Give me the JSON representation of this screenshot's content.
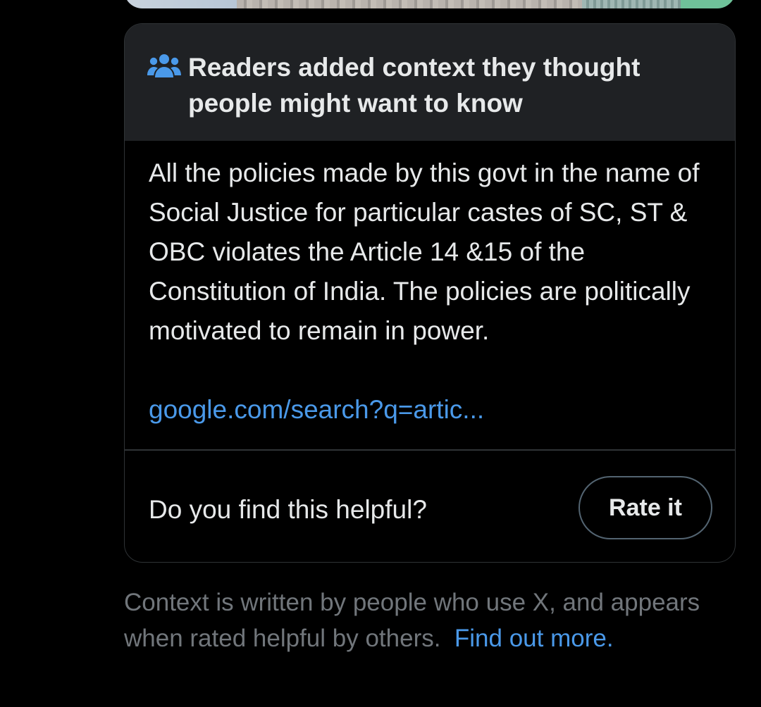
{
  "colors": {
    "background": "#000000",
    "header_bg": "#1f2124",
    "text_primary": "#e7e9ea",
    "text_secondary": "#71767b",
    "link": "#4a99e9",
    "border": "#2f3336",
    "accent_icon": "#4a99e9"
  },
  "media_preview": {
    "icon": "image-thumbnail-strip"
  },
  "community_note": {
    "header_icon": "people-icon",
    "header_title": "Readers added context they thought people might want to know",
    "body": "All the policies made by this govt in the name of Social Justice for particular castes of SC, ST & OBC violates the Article 14 &15 of the Constitution of India. The policies are politically motivated to remain in power.",
    "link_text": "google.com/search?q=artic...",
    "helpful_question": "Do you find this helpful?",
    "rate_button_label": "Rate it"
  },
  "footer": {
    "text": "Context is written by people who use X, and appears when rated helpful by others.",
    "link_text": "Find out more."
  }
}
